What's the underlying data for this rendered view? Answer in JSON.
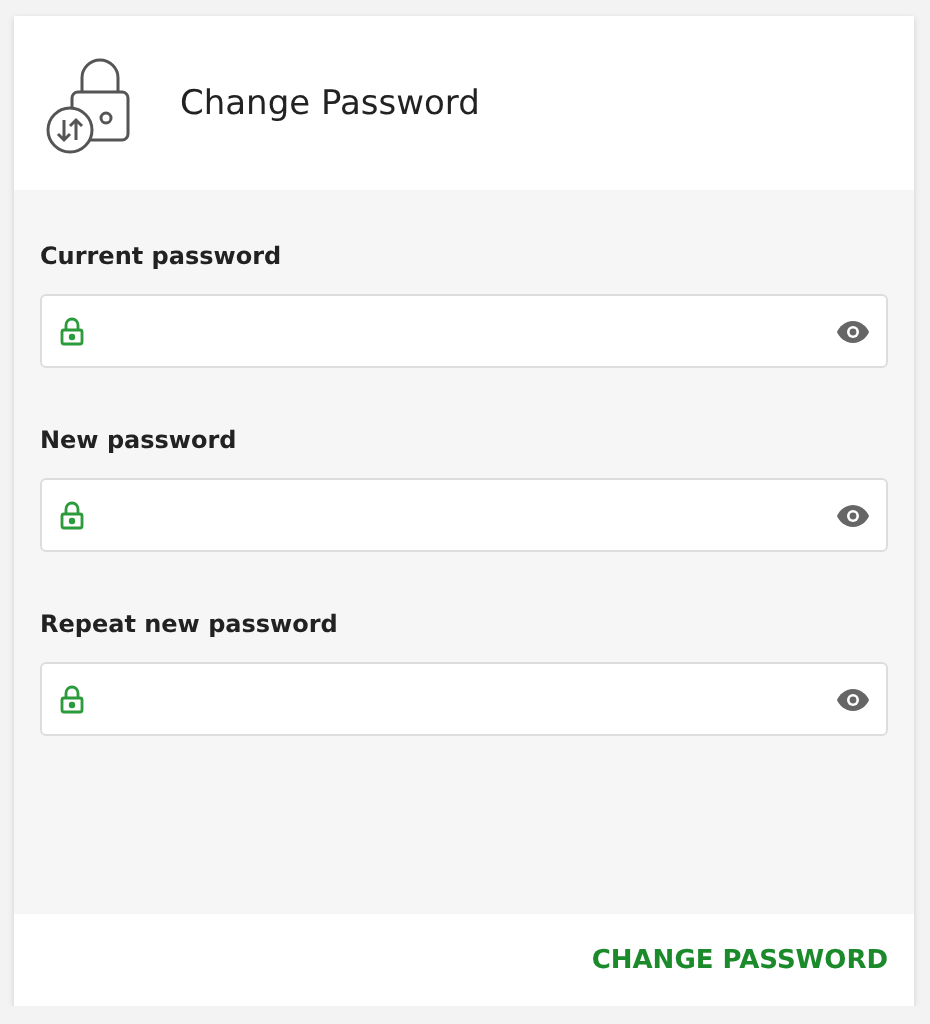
{
  "header": {
    "title": "Change Password"
  },
  "fields": [
    {
      "label": "Current password"
    },
    {
      "label": "New password"
    },
    {
      "label": "Repeat new password"
    }
  ],
  "footer": {
    "button": "CHANGE PASSWORD"
  }
}
